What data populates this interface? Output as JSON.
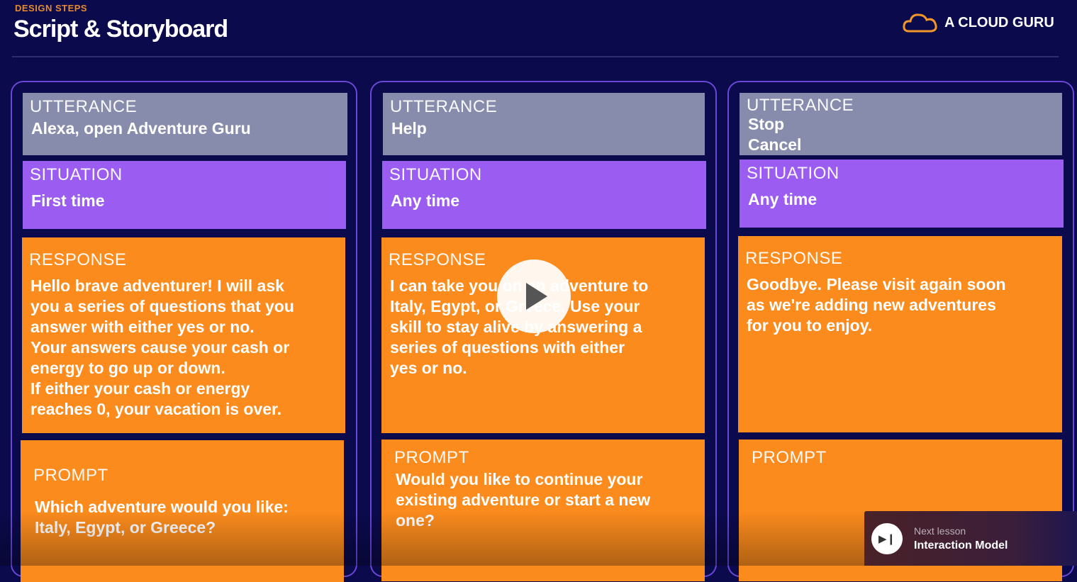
{
  "header": {
    "eyebrow": "DESIGN STEPS",
    "title": "Script & Storyboard",
    "logo_text": "A CLOUD GURU"
  },
  "labels": {
    "utterance": "UTTERANCE",
    "situation": "SITUATION",
    "response": "RESPONSE",
    "prompt": "PROMPT"
  },
  "columns": [
    {
      "utterance": "Alexa, open Adventure Guru",
      "situation": "First time",
      "response": "Hello brave adventurer! I will ask\nyou a series of questions that you\nanswer with either yes or no.\nYour answers cause your cash or\nenergy to go up or down.\nIf either your cash or energy\nreaches 0, your vacation is over.",
      "prompt": "Which adventure would you like:\nItaly, Egypt, or Greece?"
    },
    {
      "utterance": "Help",
      "situation": "Any time",
      "response": "I can take you on an adventure to\nItaly, Egypt, or Greece. Use your\nskill to stay alive by answering a\nseries of questions with either\nyes or no.",
      "prompt": "Would you like to continue your\nexisting adventure or start a new\none?"
    },
    {
      "utterance": "Stop\nCancel",
      "situation": "Any time",
      "response": "Goodbye. Please visit again soon\nas we're adding new adventures\nfor you to enjoy.",
      "prompt": ""
    }
  ],
  "next_lesson": {
    "label": "Next lesson",
    "title": "Interaction Model"
  },
  "colors": {
    "background": "#0b0a4c",
    "utterance": "#878cad",
    "situation": "#9a5cf1",
    "response": "#fb8b1d",
    "accent": "#e58a2e"
  }
}
